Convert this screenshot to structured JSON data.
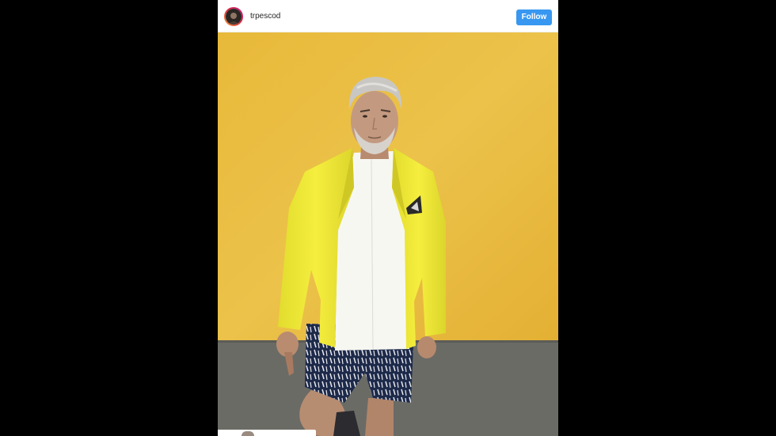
{
  "post": {
    "username": "trpescod",
    "follow_label": "Follow"
  },
  "icons": {
    "avatar": "profile-avatar",
    "photo": "post-photo-man-yellow-blazer"
  },
  "colors": {
    "page_background": "#000000",
    "follow_button": "#3897f0",
    "wall_yellow": "#e7b83c",
    "wall_gray": "#6b6b66",
    "blazer": "#f2ea3a"
  }
}
